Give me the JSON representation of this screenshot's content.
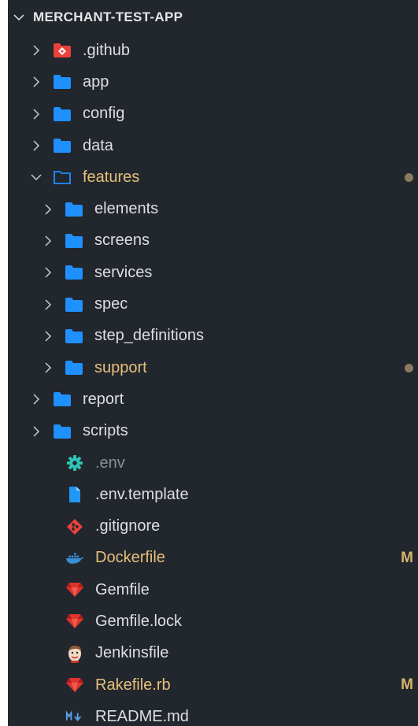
{
  "explorer": {
    "title": "MERCHANT-TEST-APP",
    "items": [
      {
        "label": ".github",
        "kind": "folder-collapsed",
        "icon": "github-folder-icon",
        "color": "#e8423a",
        "depth": 0
      },
      {
        "label": "app",
        "kind": "folder-collapsed",
        "icon": "folder-icon",
        "color": "#1e90ff",
        "depth": 0
      },
      {
        "label": "config",
        "kind": "folder-collapsed",
        "icon": "folder-icon",
        "color": "#1e90ff",
        "depth": 0
      },
      {
        "label": "data",
        "kind": "folder-collapsed",
        "icon": "folder-icon",
        "color": "#1e90ff",
        "depth": 0
      },
      {
        "label": "features",
        "kind": "folder-expanded",
        "icon": "folder-open-icon",
        "color": "#1e90ff",
        "depth": 0,
        "modified": true,
        "dot": true
      },
      {
        "label": "elements",
        "kind": "folder-collapsed",
        "icon": "folder-icon",
        "color": "#1e90ff",
        "depth": 1
      },
      {
        "label": "screens",
        "kind": "folder-collapsed",
        "icon": "folder-icon",
        "color": "#1e90ff",
        "depth": 1
      },
      {
        "label": "services",
        "kind": "folder-collapsed",
        "icon": "folder-icon",
        "color": "#1e90ff",
        "depth": 1
      },
      {
        "label": "spec",
        "kind": "folder-collapsed",
        "icon": "folder-icon",
        "color": "#1e90ff",
        "depth": 1
      },
      {
        "label": "step_definitions",
        "kind": "folder-collapsed",
        "icon": "folder-icon",
        "color": "#1e90ff",
        "depth": 1
      },
      {
        "label": "support",
        "kind": "folder-collapsed",
        "icon": "folder-icon",
        "color": "#1e90ff",
        "depth": 1,
        "modified": true,
        "dot": true
      },
      {
        "label": "report",
        "kind": "folder-collapsed",
        "icon": "folder-icon",
        "color": "#1e90ff",
        "depth": 0
      },
      {
        "label": "scripts",
        "kind": "folder-collapsed",
        "icon": "folder-icon",
        "color": "#1e90ff",
        "depth": 0
      },
      {
        "label": ".env",
        "kind": "file",
        "icon": "gear-icon",
        "color": "#2ec4b6",
        "ignored": true
      },
      {
        "label": ".env.template",
        "kind": "file",
        "icon": "file-icon",
        "color": "#2196f3"
      },
      {
        "label": ".gitignore",
        "kind": "file",
        "icon": "git-icon",
        "color": "#e8423a"
      },
      {
        "label": "Dockerfile",
        "kind": "file",
        "icon": "docker-icon",
        "color": "#3a8fd6",
        "modified": true,
        "status": "M"
      },
      {
        "label": "Gemfile",
        "kind": "file",
        "icon": "ruby-gem-icon",
        "color": "#e0342e"
      },
      {
        "label": "Gemfile.lock",
        "kind": "file",
        "icon": "ruby-gem-icon",
        "color": "#e0342e"
      },
      {
        "label": "Jenkinsfile",
        "kind": "file",
        "icon": "jenkins-icon",
        "color": "#d9b38c"
      },
      {
        "label": "Rakefile.rb",
        "kind": "file",
        "icon": "ruby-gem-icon",
        "color": "#e0342e",
        "modified": true,
        "status": "M"
      },
      {
        "label": "README.md",
        "kind": "file",
        "icon": "markdown-icon",
        "color": "#5aa0e8"
      }
    ]
  }
}
